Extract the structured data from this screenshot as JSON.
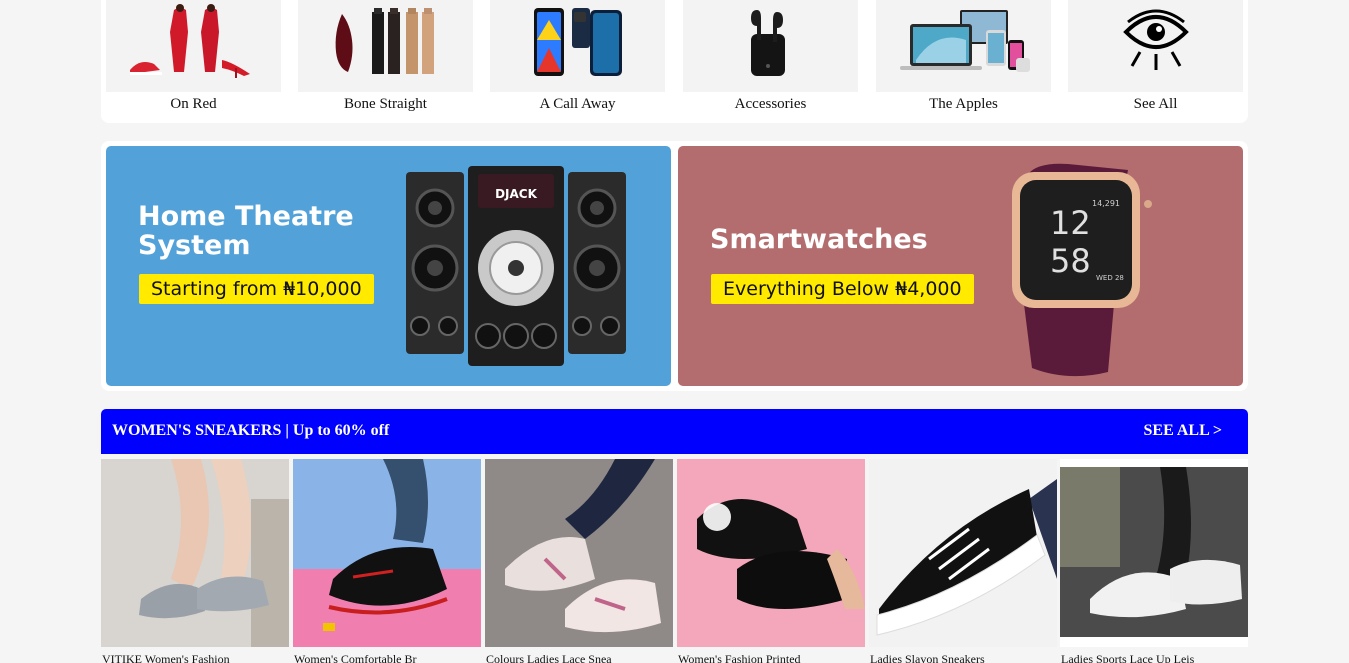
{
  "categories": [
    {
      "label": "On Red",
      "icon": "red-dress-icon"
    },
    {
      "label": "Bone Straight",
      "icon": "hair-bundle-icon"
    },
    {
      "label": "A Call Away",
      "icon": "smartphone-icon"
    },
    {
      "label": "Accessories",
      "icon": "earbuds-icon"
    },
    {
      "label": "The Apples",
      "icon": "apple-devices-icon"
    },
    {
      "label": "See All",
      "icon": "eye-icon"
    }
  ],
  "banners": {
    "left": {
      "headline_1": "Home Theatre",
      "headline_2": "System",
      "pill": "Starting from ₦10,000",
      "brand": "DJACK",
      "bg": "#52a2d9"
    },
    "right": {
      "headline": "Smartwatches",
      "pill": "Everything Below ₦4,000",
      "watch_hour": "12",
      "watch_min": "58",
      "watch_date": "WED 28",
      "watch_top": "14,291",
      "bg": "#b36d6e"
    }
  },
  "section": {
    "title": "WOMEN'S SNEAKERS | Up to 60% off",
    "see_all": "SEE ALL >",
    "color": "#0000ff"
  },
  "products": [
    {
      "name": "VITIKE Women's Fashion"
    },
    {
      "name": "Women's Comfortable Br"
    },
    {
      "name": "Colours Ladies Lace Snea"
    },
    {
      "name": "Women's Fashion Printed"
    },
    {
      "name": "Ladies Slavon Sneakers"
    },
    {
      "name": "Ladies Sports Lace Up Leis"
    }
  ]
}
